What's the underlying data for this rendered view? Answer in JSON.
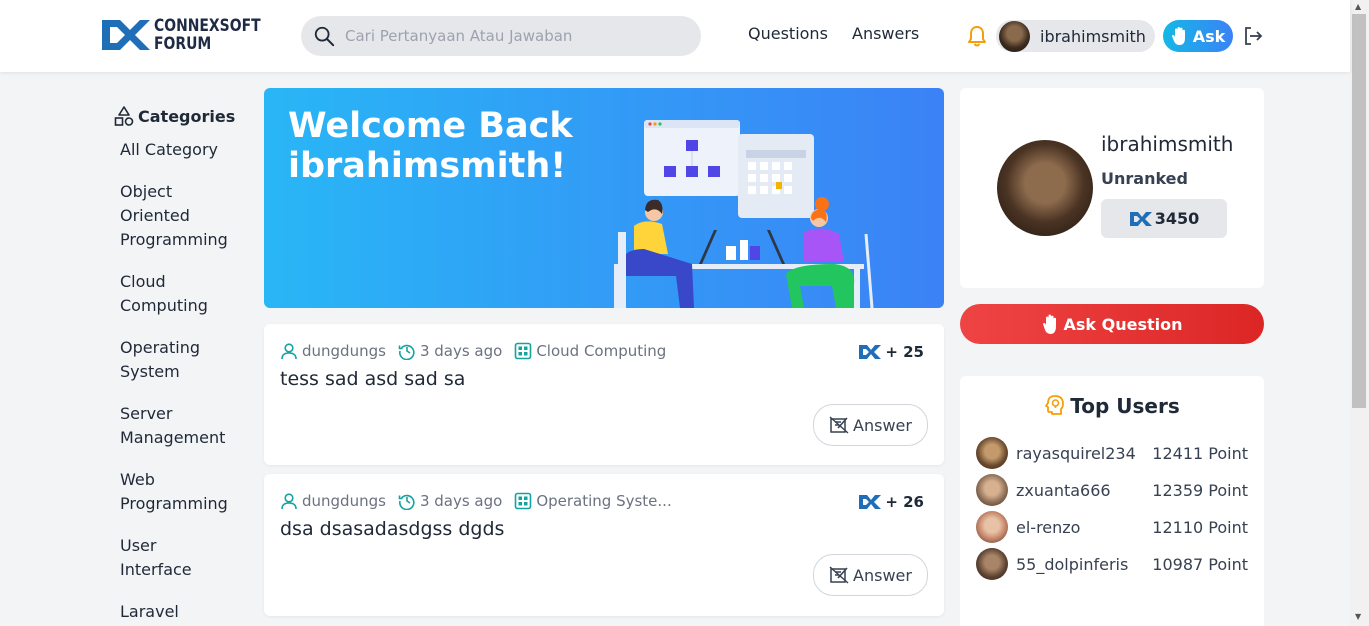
{
  "header": {
    "logo_line1": "CONNEXSOFT",
    "logo_line2": "FORUM",
    "search_placeholder": "Cari Pertanyaan Atau Jawaban",
    "nav": [
      "Questions",
      "Answers"
    ],
    "username": "ibrahimsmith",
    "ask_label": "Ask"
  },
  "sidebar": {
    "title": "Categories",
    "items": [
      "All Category",
      "Object Oriented Programming",
      "Cloud Computing",
      "Operating System",
      "Server Management",
      "Web Programming",
      "User Interface",
      "Laravel"
    ]
  },
  "banner": {
    "line1": "Welcome Back",
    "line2": "ibrahimsmith!"
  },
  "questions": [
    {
      "author": "dungdungs",
      "time": "3 days ago",
      "category": "Cloud Computing",
      "points": "+ 25",
      "title": "tess sad asd sad sa",
      "answer_label": "Answer"
    },
    {
      "author": "dungdungs",
      "time": "3 days ago",
      "category": "Operating Syste...",
      "points": "+ 26",
      "title": "dsa dsasadasdgss dgds",
      "answer_label": "Answer"
    }
  ],
  "profile": {
    "name": "ibrahimsmith",
    "rank": "Unranked",
    "points": "3450"
  },
  "ask_question_label": "Ask Question",
  "top_users": {
    "title": "Top Users",
    "users": [
      {
        "name": "rayasquirel234",
        "points": "12411 Point"
      },
      {
        "name": "zxuanta666",
        "points": "12359 Point"
      },
      {
        "name": "el-renzo",
        "points": "12110 Point"
      },
      {
        "name": "55_dolpinferis",
        "points": "10987 Point"
      }
    ]
  },
  "colors": {
    "brand": "#1e6fb8",
    "accent_blue": "#3b82f6",
    "ask_red": "#ef4444",
    "teal": "#14a3a3"
  }
}
